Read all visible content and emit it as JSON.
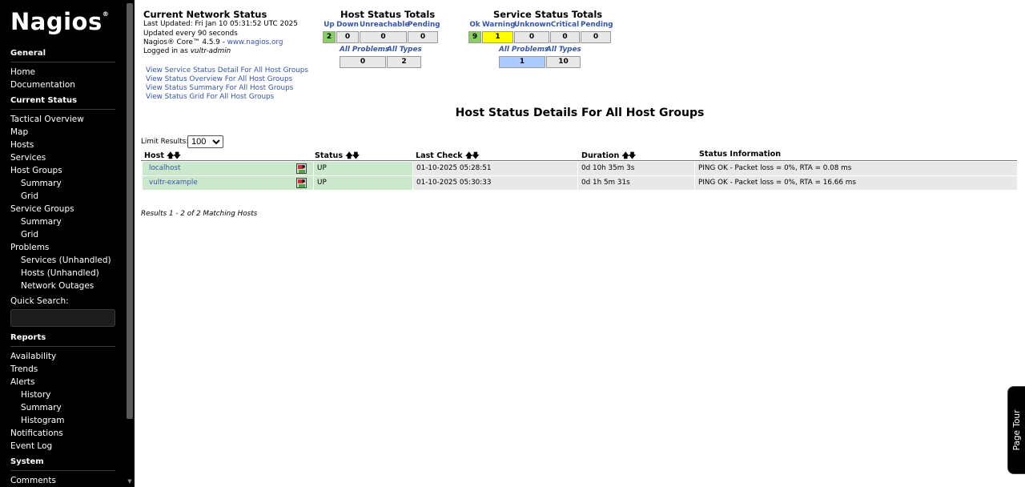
{
  "sidebar": {
    "logo": "Nagios",
    "logo_mark": "®",
    "sections": {
      "general": "General",
      "current_status": "Current Status",
      "reports": "Reports",
      "system": "System"
    },
    "general_items": [
      "Home",
      "Documentation"
    ],
    "current_status_items": [
      "Tactical Overview",
      "Map",
      "Hosts",
      "Services",
      "Host Groups",
      "Summary",
      "Grid",
      "Service Groups",
      "Summary",
      "Grid",
      "Problems",
      "Services (Unhandled)",
      "Hosts (Unhandled)",
      "Network Outages"
    ],
    "quick_search_label": "Quick Search:",
    "quick_search_value": "",
    "reports_items": [
      "Availability",
      "Trends",
      "Alerts",
      "History",
      "Summary",
      "Histogram",
      "Notifications",
      "Event Log"
    ],
    "system_items": [
      "Comments"
    ]
  },
  "status_info": {
    "title": "Current Network Status",
    "last_updated": "Last Updated: Fri Jan 10 05:31:52 UTC 2025",
    "interval": "Updated every 90 seconds",
    "core_prefix": "Nagios® Core™ 4.5.9 - ",
    "core_link": "www.nagios.org",
    "logged_prefix": "Logged in as ",
    "user": "vultr-admin"
  },
  "view_links": [
    "View Service Status Detail For All Host Groups",
    "View Status Overview For All Host Groups",
    "View Status Summary For All Host Groups",
    "View Status Grid For All Host Groups"
  ],
  "host_totals": {
    "title": "Host Status Totals",
    "headers": [
      "Up",
      "Down",
      "Unreachable",
      "Pending"
    ],
    "values": [
      "2",
      "0",
      "0",
      "0"
    ],
    "sub_headers": [
      "All Problems",
      "All Types"
    ],
    "sub_values": [
      "0",
      "2"
    ]
  },
  "service_totals": {
    "title": "Service Status Totals",
    "headers": [
      "Ok",
      "Warning",
      "Unknown",
      "Critical",
      "Pending"
    ],
    "values": [
      "9",
      "1",
      "0",
      "0",
      "0"
    ],
    "sub_headers": [
      "All Problems",
      "All Types"
    ],
    "sub_values": [
      "1",
      "10"
    ]
  },
  "details": {
    "title": "Host Status Details For All Host Groups",
    "limit_label": "Limit Results:",
    "limit_value": "100",
    "columns": [
      "Host",
      "Status",
      "Last Check",
      "Duration",
      "Status Information"
    ],
    "rows": [
      {
        "host": "localhost",
        "status": "UP",
        "last_check": "01-10-2025 05:28:51",
        "duration": "0d 10h 35m 3s",
        "info": "PING OK - Packet loss = 0%, RTA = 0.08 ms"
      },
      {
        "host": "vultr-example",
        "status": "UP",
        "last_check": "01-10-2025 05:30:33",
        "duration": "0d 1h 5m 31s",
        "info": "PING OK - Packet loss = 0%, RTA = 16.66 ms"
      }
    ],
    "results": "Results 1 - 2 of 2 Matching Hosts"
  },
  "page_tour": "Page Tour",
  "colors": {
    "up_green": "#88d066",
    "warning_yellow": "#ffff00",
    "problem_blue": "#aaccff",
    "row_green": "#cce8cc",
    "link_blue": "#3355aa"
  },
  "icons": {
    "host_action": "host-graph-icon",
    "sort": "sort-arrows-icon"
  }
}
